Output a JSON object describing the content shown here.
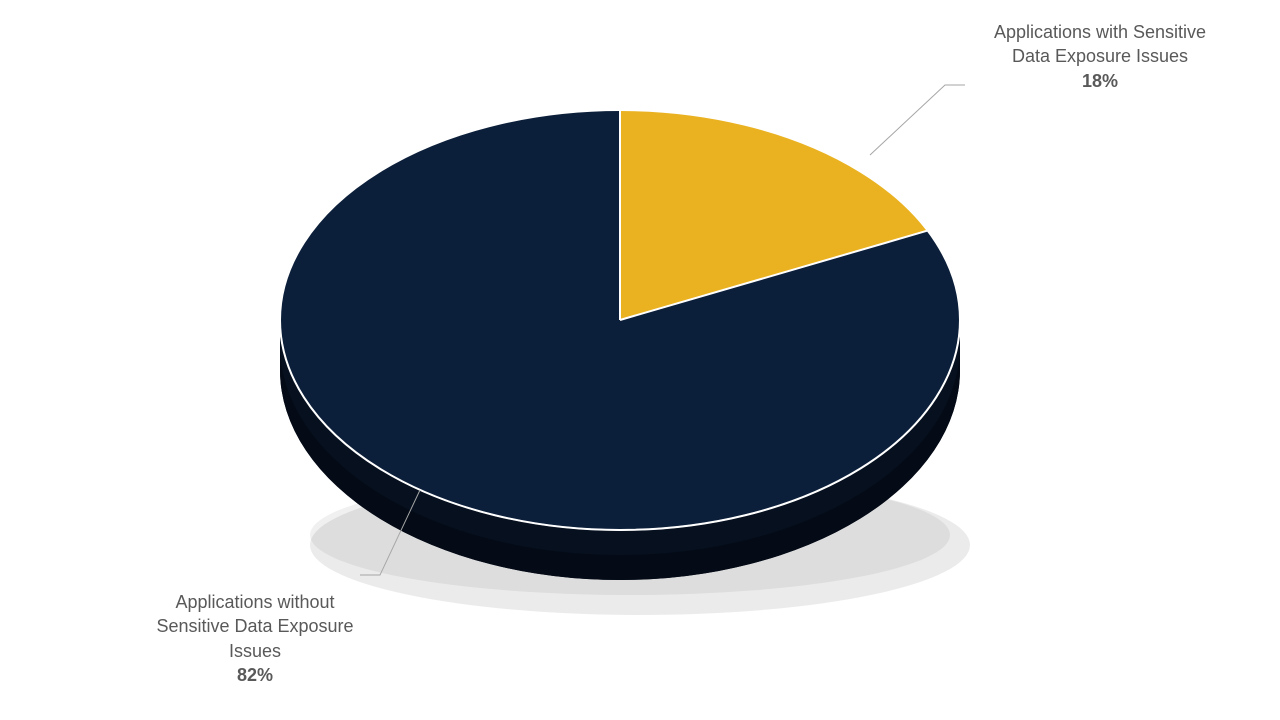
{
  "chart_data": {
    "type": "pie",
    "slices": [
      {
        "name": "Applications with Sensitive Data Exposure Issues",
        "value": 18,
        "color": "#eab220",
        "side": "#b8860b"
      },
      {
        "name": "Applications without Sensitive Data Exposure Issues",
        "value": 82,
        "color": "#0c1f3a",
        "side": "#06101f"
      }
    ],
    "labels": {
      "slice1_line1": "Applications with Sensitive",
      "slice1_line2": "Data Exposure Issues",
      "slice1_pct": "18%",
      "slice2_line1": "Applications without",
      "slice2_line2": "Sensitive Data Exposure",
      "slice2_line3": "Issues",
      "slice2_pct": "82%"
    }
  }
}
